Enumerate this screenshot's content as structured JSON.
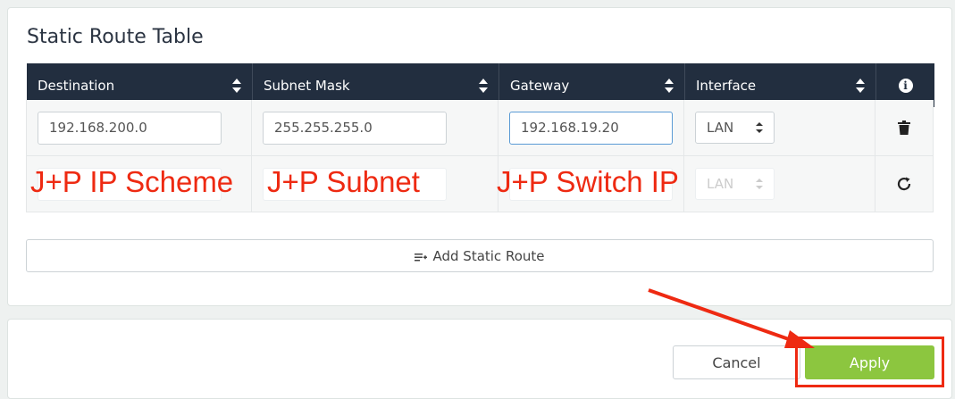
{
  "page": {
    "title": "Static Route Table"
  },
  "table": {
    "headers": [
      "Destination",
      "Subnet Mask",
      "Gateway",
      "Interface"
    ],
    "rows": [
      {
        "destination": "192.168.200.0",
        "subnet_mask": "255.255.255.0",
        "gateway": "192.168.19.20",
        "interface": "LAN",
        "action_icon": "trash-icon"
      },
      {
        "destination": "",
        "subnet_mask": "",
        "gateway": "",
        "interface": "LAN",
        "action_icon": "refresh-icon"
      }
    ]
  },
  "annotations": {
    "ip_scheme": "J+P IP Scheme",
    "subnet": "J+P Subnet",
    "switch_ip": "J+P Switch IP"
  },
  "buttons": {
    "add_static_route": "Add Static Route",
    "cancel": "Cancel",
    "apply": "Apply"
  },
  "colors": {
    "header_bg": "#222e3f",
    "apply_green": "#8cc63f",
    "annotation_red": "#ee2a12"
  }
}
